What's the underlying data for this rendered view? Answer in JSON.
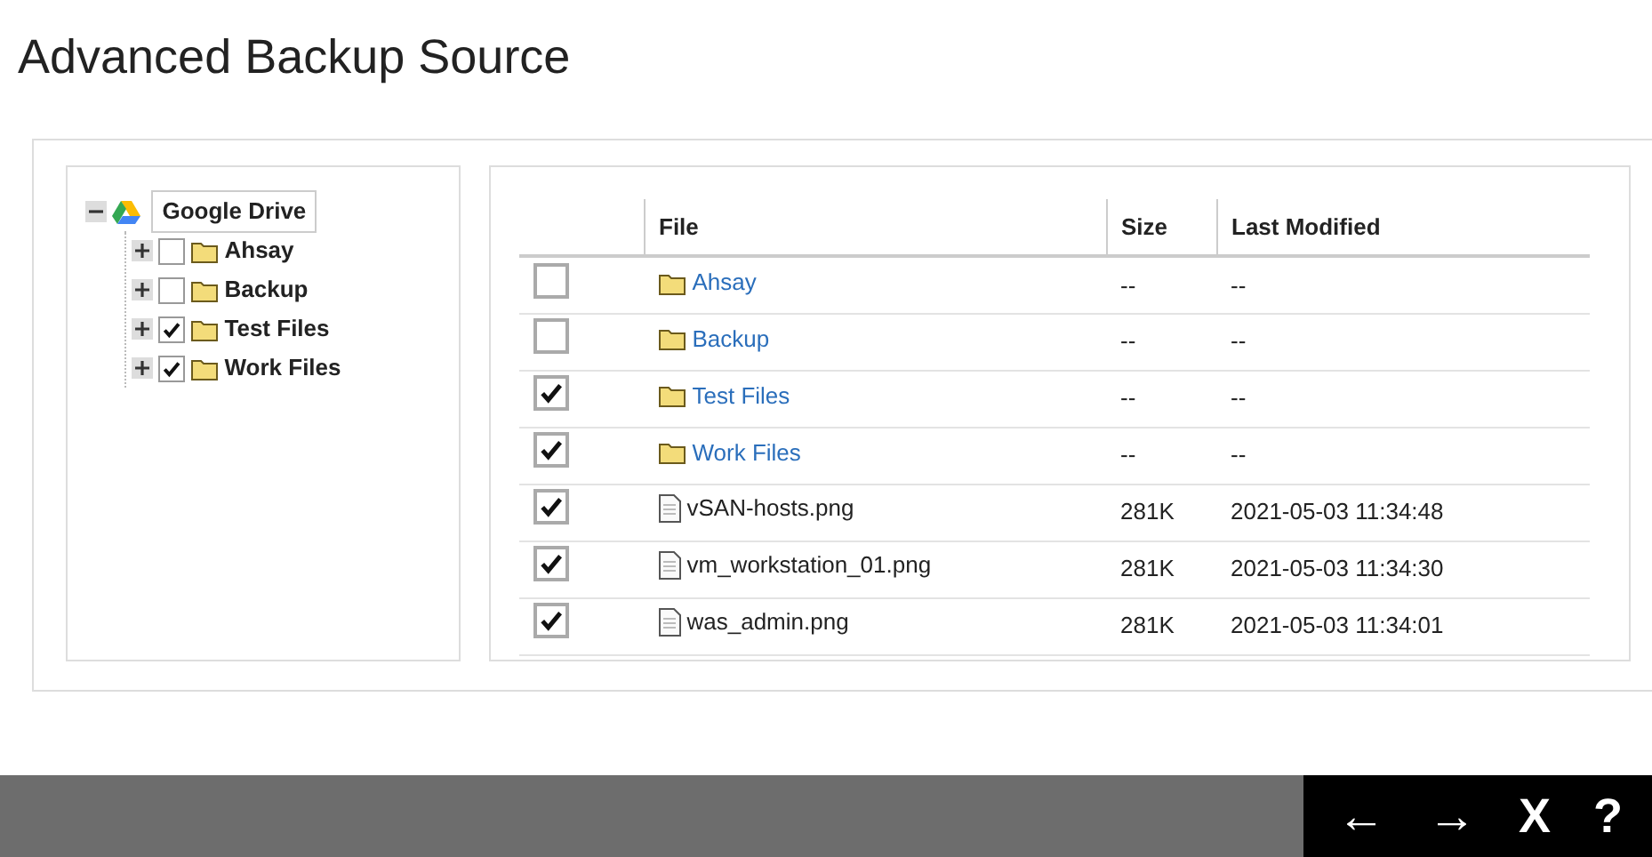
{
  "title": "Advanced Backup Source",
  "tree": {
    "label": "Google Drive",
    "expanded": true,
    "children": [
      {
        "label": "Ahsay",
        "expanded": false,
        "checked": false
      },
      {
        "label": "Backup",
        "expanded": false,
        "checked": false
      },
      {
        "label": "Test Files",
        "expanded": false,
        "checked": true
      },
      {
        "label": "Work Files",
        "expanded": false,
        "checked": true
      }
    ]
  },
  "table": {
    "columns": [
      "File",
      "Size",
      "Last Modified"
    ],
    "rows": [
      {
        "kind": "folder",
        "checked": false,
        "name": "Ahsay",
        "size": "--",
        "modified": "--"
      },
      {
        "kind": "folder",
        "checked": false,
        "name": "Backup",
        "size": "--",
        "modified": "--"
      },
      {
        "kind": "folder",
        "checked": true,
        "name": "Test Files",
        "size": "--",
        "modified": "--"
      },
      {
        "kind": "folder",
        "checked": true,
        "name": "Work Files",
        "size": "--",
        "modified": "--"
      },
      {
        "kind": "file",
        "checked": true,
        "name": "vSAN-hosts.png",
        "size": "281K",
        "modified": "2021-05-03 11:34:48"
      },
      {
        "kind": "file",
        "checked": true,
        "name": "vm_workstation_01.png",
        "size": "281K",
        "modified": "2021-05-03 11:34:30"
      },
      {
        "kind": "file",
        "checked": true,
        "name": "was_admin.png",
        "size": "281K",
        "modified": "2021-05-03 11:34:01"
      }
    ]
  },
  "nav_buttons": [
    "←",
    "→",
    "X",
    "?"
  ]
}
